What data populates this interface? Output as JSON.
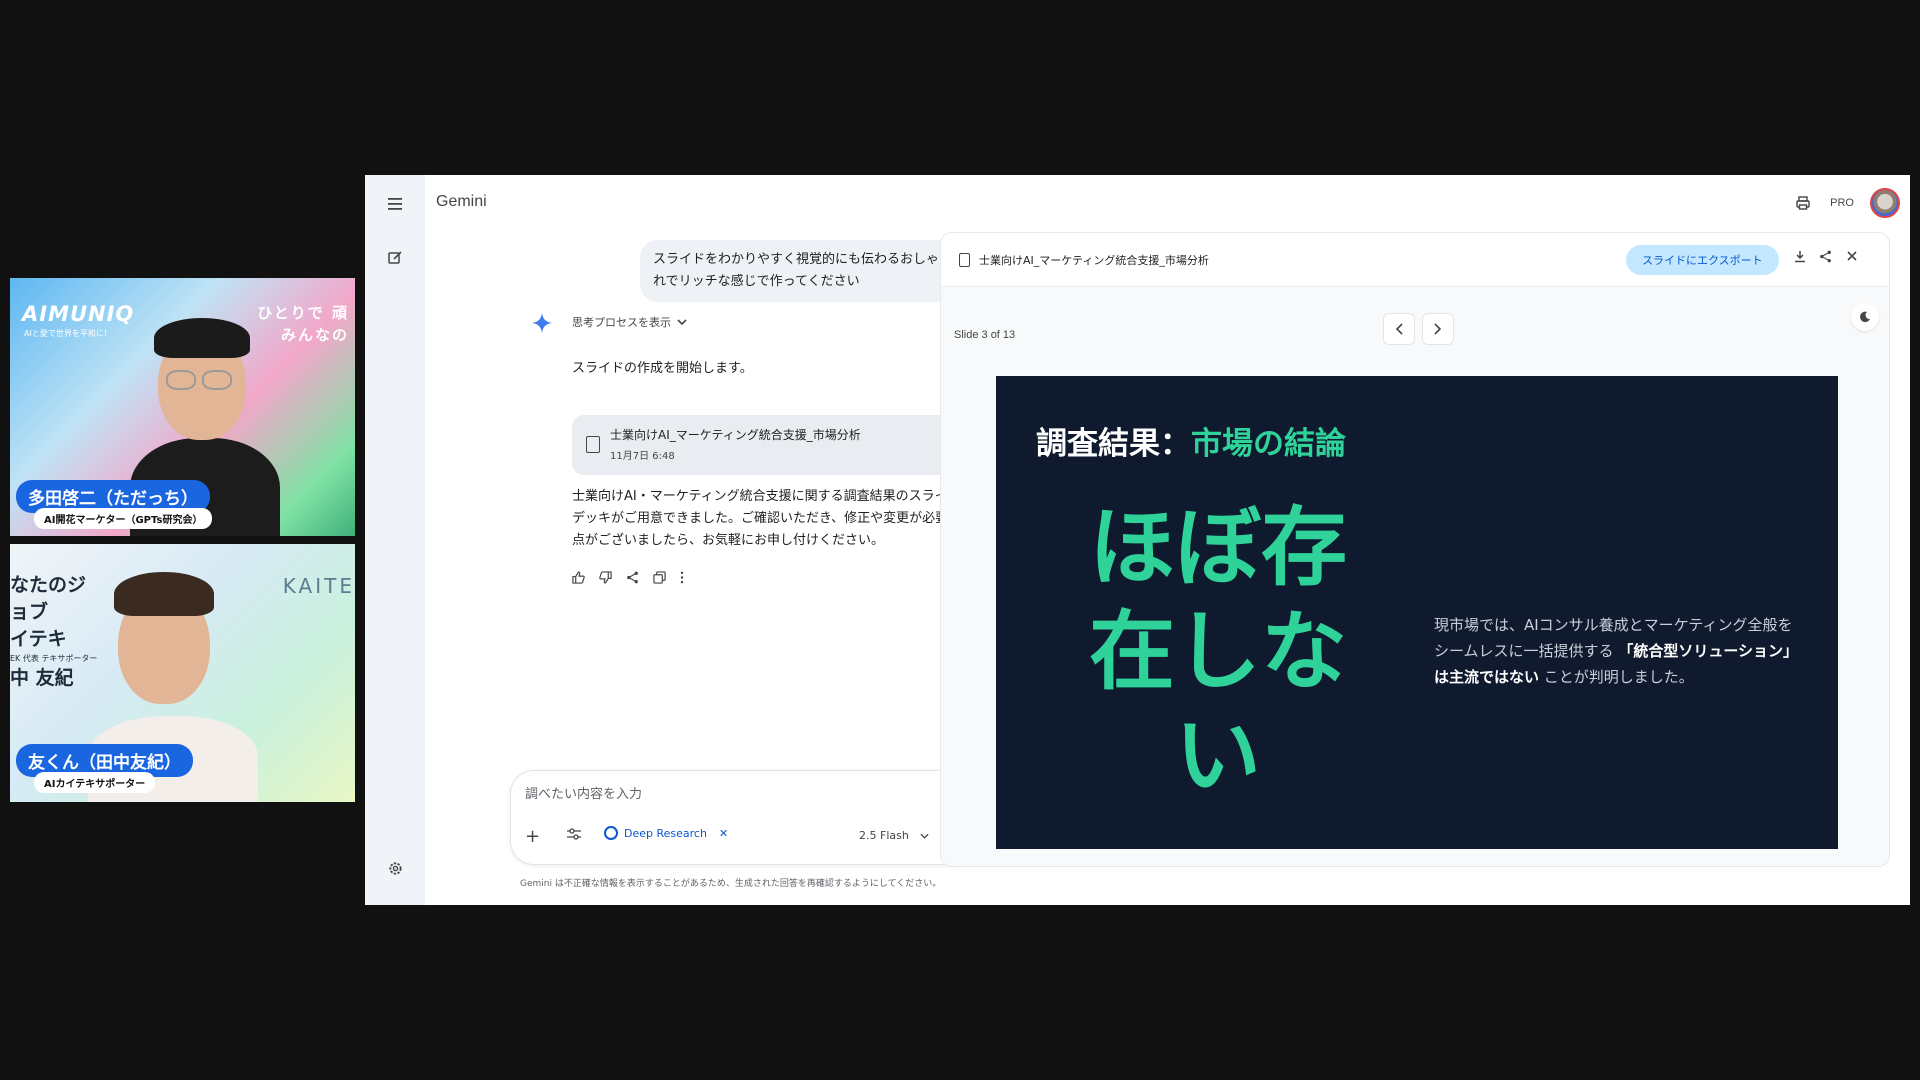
{
  "participants": [
    {
      "name": "多田啓二（ただっち）",
      "role": "AI開花マーケター（GPTs研究会）",
      "bg_brand": "AIMUNIQ",
      "bg_brand_sub": "AIと愛で世界を平和に!",
      "bg_catch": "ひとりで 頑 みんなの"
    },
    {
      "name": "友くん（田中友紀）",
      "role": "AIカイテキサポーター",
      "bg_brand": "KAITE",
      "bg_text_1": "なたのジョブ",
      "bg_text_2": "イテキ",
      "bg_small": "EK 代表 テキサポーター",
      "bg_name": "中 友紀"
    }
  ],
  "app": {
    "title": "Gemini",
    "pro_label": "PRO"
  },
  "chat": {
    "user_message": "スライドをわかりやすく視覚的にも伝わるおしゃれでリッチな感じで作ってください",
    "thinking_label": "思考プロセスを表示",
    "response_1": "スライドの作成を開始します。",
    "doc_card": {
      "title": "士業向けAI_マーケティング統合支援_市場分析",
      "date": "11月7日 6:48"
    },
    "response_2": "士業向けAI・マーケティング統合支援に関する調査結果のスライドデッキがご用意できました。ご確認いただき、修正や変更が必要な点がございましたら、お気軽にお申し付けください。"
  },
  "composer": {
    "placeholder": "調べたい内容を入力",
    "chip_label": "Deep Research",
    "model": "2.5 Flash"
  },
  "disclaimer": "Gemini は不正確な情報を表示することがあるため、生成された回答を再確認するようにしてください。",
  "preview": {
    "doc_title": "士業向けAI_マーケティング統合支援_市場分析",
    "export_label": "スライドにエクスポート",
    "slide_counter": "Slide 3 of 13",
    "slide": {
      "title_prefix": "調査結果：",
      "title_accent": "市場の結論",
      "hero": "ほぼ存在しない",
      "body_pre": "現市場では、AIコンサル養成とマーケティング全般をシームレスに一括提供する",
      "body_bold": "「統合型ソリューション」は主流ではない",
      "body_post": "ことが判明しました。"
    }
  },
  "colors": {
    "accent_green": "#2fd39a",
    "slide_bg": "#0f1a2e",
    "name_pill": "#1a66e0",
    "export_btn": "#c2e7ff"
  }
}
